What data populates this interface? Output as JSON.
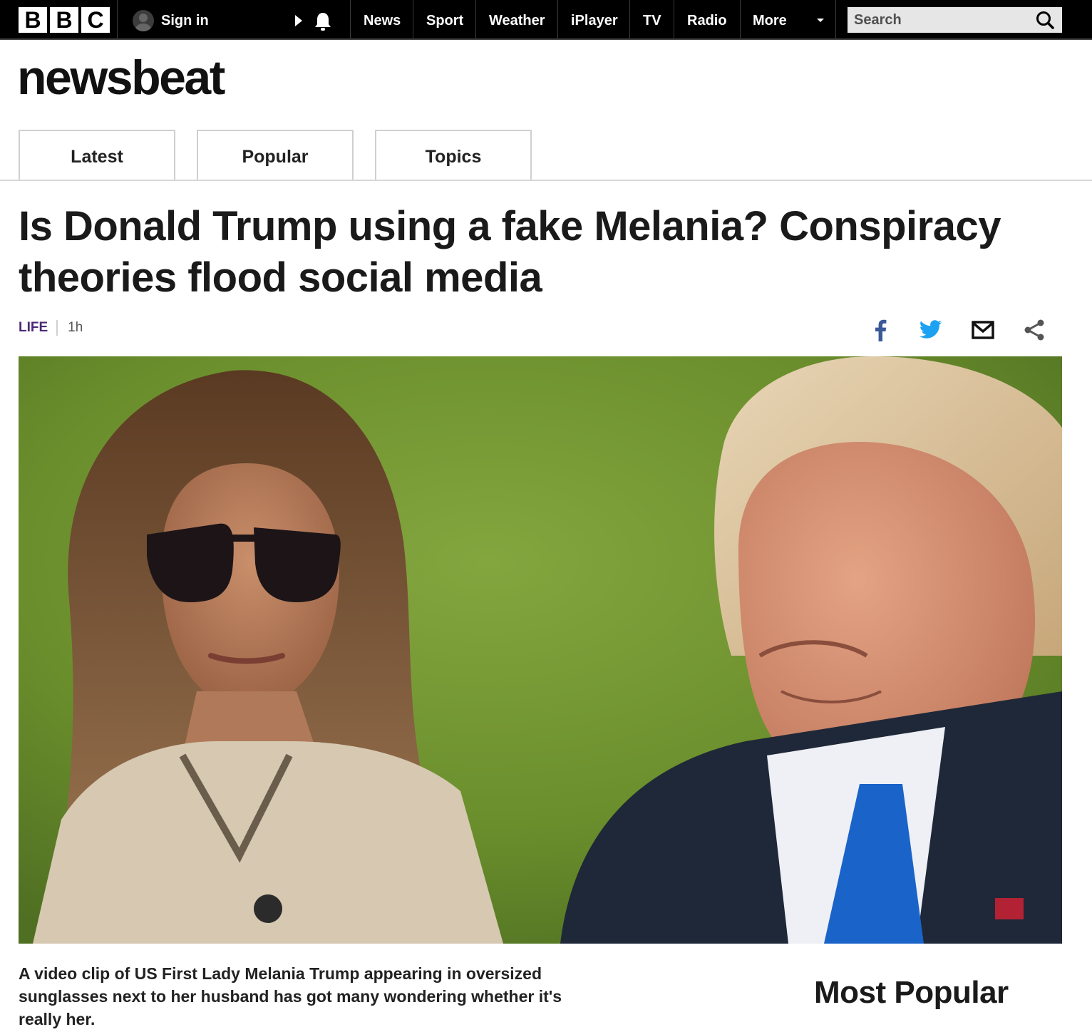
{
  "topbar": {
    "logo_letters": [
      "B",
      "B",
      "C"
    ],
    "signin_label": "Sign in",
    "nav": [
      {
        "label": "News"
      },
      {
        "label": "Sport"
      },
      {
        "label": "Weather"
      },
      {
        "label": "iPlayer"
      },
      {
        "label": "TV"
      },
      {
        "label": "Radio"
      },
      {
        "label": "More"
      }
    ],
    "search_placeholder": "Search"
  },
  "header": {
    "brand": "newsbeat",
    "tabs": [
      {
        "label": "Latest"
      },
      {
        "label": "Popular"
      },
      {
        "label": "Topics"
      }
    ]
  },
  "article": {
    "headline": "Is Donald Trump using a fake Melania? Conspiracy theories flood social media",
    "category": "LIFE",
    "time": "1h",
    "share_icons": [
      "facebook-icon",
      "twitter-icon",
      "email-icon",
      "share-icon"
    ],
    "summary": "A video clip of US First Lady Melania Trump appearing in oversized sunglasses next to her husband has got many wondering whether it's really her."
  },
  "sidebar": {
    "heading": "Most Popular"
  },
  "colors": {
    "topbar_bg": "#000000",
    "category": "#4a2876",
    "facebook": "#3b5998",
    "twitter": "#1da1f2",
    "photo_background": "#6f9330"
  }
}
